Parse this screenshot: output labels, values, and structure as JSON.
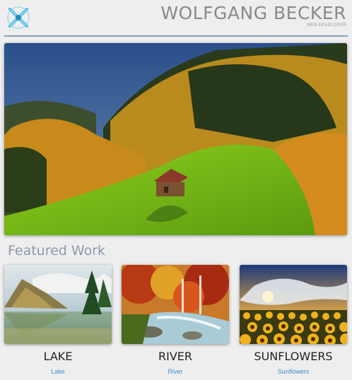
{
  "header": {
    "logo_icon": "cross-logo-icon",
    "name": "WOLFGANG BECKER",
    "subtitle": "WEB DEVELOPER",
    "accent": "#8aa0b5"
  },
  "hero": {
    "image": "autumn-meadow-hut-photo"
  },
  "featured": {
    "title": "Featured Work",
    "items": [
      {
        "title": "LAKE",
        "link": "Lake",
        "image": "mountain-lake-photo"
      },
      {
        "title": "RIVER",
        "link": "River",
        "image": "autumn-river-photo"
      },
      {
        "title": "SUNFLOWERS",
        "link": "Sunflowers",
        "image": "sunflower-field-photo"
      }
    ]
  },
  "colors": {
    "background": "#eeeeee",
    "link": "#3a8fc8",
    "section_title": "#8a9ab0"
  }
}
